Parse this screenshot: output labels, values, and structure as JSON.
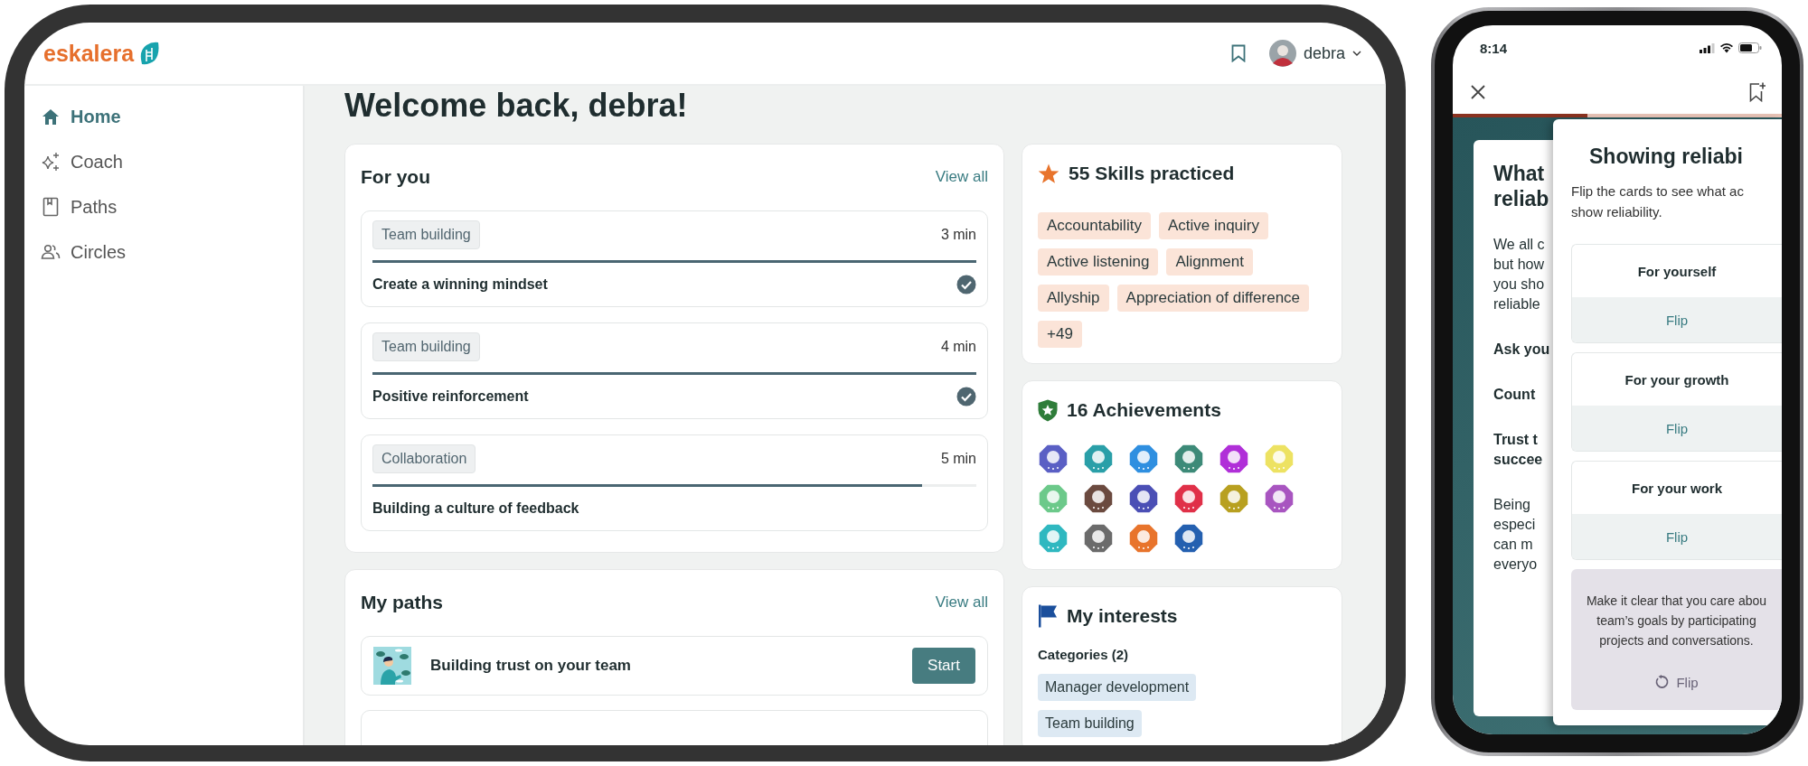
{
  "header": {
    "logo": "eskalera",
    "user": "debra"
  },
  "sidebar": {
    "items": [
      {
        "label": "Home",
        "selected": true
      },
      {
        "label": "Coach",
        "selected": false
      },
      {
        "label": "Paths",
        "selected": false
      },
      {
        "label": "Circles",
        "selected": false
      }
    ]
  },
  "title": "Welcome back, debra!",
  "for_you": {
    "title": "For you",
    "link": "View all",
    "items": [
      {
        "tag": "Team building",
        "duration": "3 min",
        "level": 1,
        "title": "Create a winning mindset",
        "completed": true
      },
      {
        "tag": "Team building",
        "duration": "4 min",
        "level": 1,
        "title": "Positive reinforcement",
        "completed": true
      },
      {
        "tag": "Collaboration",
        "duration": "5 min",
        "level": 0.91,
        "title": "Building a culture of feedback",
        "completed": false
      }
    ]
  },
  "my_paths": {
    "title": "My paths",
    "link": "View all",
    "items": [
      {
        "title": "Building trust on your team",
        "button": "Start"
      }
    ]
  },
  "skills": {
    "title": "55 Skills practiced",
    "tags": [
      "Accountability",
      "Active inquiry",
      "Active listening",
      "Alignment",
      "Allyship",
      "Appreciation of difference",
      "+49"
    ]
  },
  "achievements": {
    "title": "16 Achievements",
    "badges": [
      {
        "color": "#5a5fc4"
      },
      {
        "color": "#2a9fa8"
      },
      {
        "color": "#2f8fe0"
      },
      {
        "color": "#3d8a78"
      },
      {
        "color": "#b02fd8"
      },
      {
        "color": "#ede262"
      },
      {
        "color": "#6cc98a"
      },
      {
        "color": "#6b4a3f"
      },
      {
        "color": "#4b4fb5"
      },
      {
        "color": "#e03048"
      },
      {
        "color": "#b8a020"
      },
      {
        "color": "#a855c0"
      },
      {
        "color": "#2fb8c0"
      },
      {
        "color": "#6b6b6b"
      },
      {
        "color": "#e8742c"
      },
      {
        "color": "#2460b0"
      }
    ]
  },
  "interests": {
    "title": "My interests",
    "subtitle": "Categories (2)",
    "tags": [
      "Manager development",
      "Team building"
    ]
  },
  "phone": {
    "time": "8:14",
    "progress": {
      "level": 0.41
    },
    "back_card": {
      "blocks": [
        {
          "kind": "heading",
          "lines": [
            "What",
            "reliab"
          ]
        },
        {
          "kind": "text",
          "lines": [
            "We all c",
            "but how",
            "you sho",
            "reliable"
          ]
        },
        {
          "kind": "bold",
          "lines": [
            "Ask you"
          ]
        },
        {
          "kind": "bold",
          "lines": [
            "Count"
          ]
        },
        {
          "kind": "bold",
          "lines": [
            "Trust t",
            "succee"
          ]
        },
        {
          "kind": "text",
          "lines": [
            "Being",
            "especi",
            "can m",
            "everyo"
          ]
        }
      ]
    },
    "front_card": {
      "title": "Showing reliabi",
      "intro": [
        "Flip the cards to see what ac",
        "show reliability."
      ],
      "cards": [
        {
          "kind": "front",
          "title": "For yourself",
          "button": "Flip"
        },
        {
          "kind": "front",
          "title": "For your growth",
          "button": "Flip"
        },
        {
          "kind": "front",
          "title": "For your work",
          "button": "Flip"
        },
        {
          "kind": "back",
          "lines": [
            "Make it clear that you care abou",
            "team’s goals by participating",
            "projects and conversations."
          ],
          "button": "Flip"
        }
      ]
    }
  }
}
